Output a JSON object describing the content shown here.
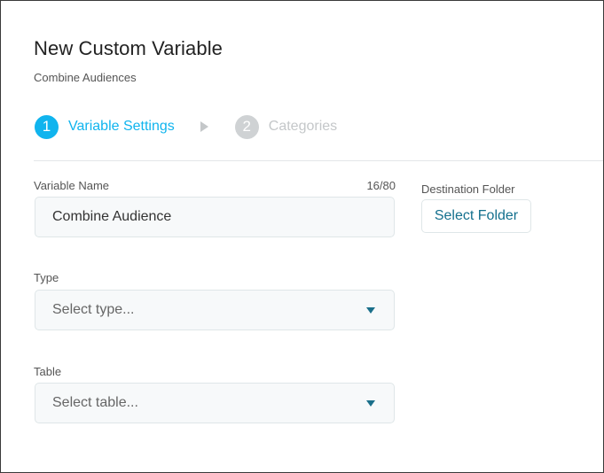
{
  "dialog": {
    "title": "New Custom Variable",
    "subtitle": "Combine Audiences"
  },
  "steps": [
    {
      "number": "1",
      "label": "Variable Settings",
      "state": "active"
    },
    {
      "number": "2",
      "label": "Categories",
      "state": "inactive"
    }
  ],
  "form": {
    "variable_name": {
      "label": "Variable Name",
      "value": "Combine Audience",
      "counter": "16/80"
    },
    "destination_folder": {
      "label": "Destination Folder",
      "button_label": "Select Folder"
    },
    "type": {
      "label": "Type",
      "placeholder": "Select type..."
    },
    "table": {
      "label": "Table",
      "placeholder": "Select table..."
    }
  },
  "colors": {
    "accent": "#10b4ee",
    "inactive": "#c4c7c9",
    "link": "#14708e"
  }
}
